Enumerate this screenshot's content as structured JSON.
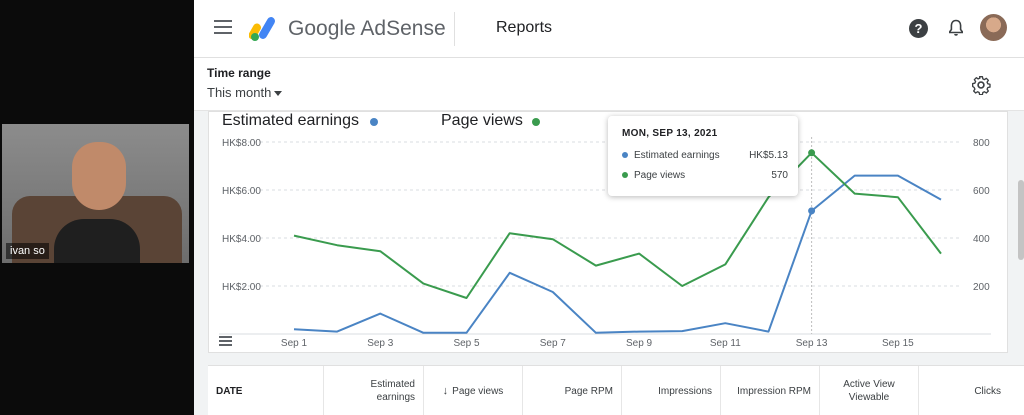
{
  "video": {
    "participant_name": "ivan so"
  },
  "header": {
    "brand": "Google AdSense",
    "section": "Reports",
    "help_symbol": "?"
  },
  "time_range": {
    "label": "Time range",
    "value": "This month"
  },
  "legend": [
    {
      "label": "Estimated earnings",
      "color": "#4a84c4"
    },
    {
      "label": "Page views",
      "color": "#3a9b4e"
    }
  ],
  "tooltip": {
    "date": "MON, SEP 13, 2021",
    "rows": [
      {
        "label": "Estimated earnings",
        "value": "HK$5.13",
        "color": "#4a84c4"
      },
      {
        "label": "Page views",
        "value": "570",
        "color": "#3a9b4e"
      }
    ]
  },
  "chart_data": {
    "type": "line",
    "x": [
      "Sep 1",
      "Sep 2",
      "Sep 3",
      "Sep 4",
      "Sep 5",
      "Sep 6",
      "Sep 7",
      "Sep 8",
      "Sep 9",
      "Sep 10",
      "Sep 11",
      "Sep 12",
      "Sep 13",
      "Sep 14",
      "Sep 15",
      "Sep 16"
    ],
    "x_tick_labels": [
      "Sep 1",
      "Sep 3",
      "Sep 5",
      "Sep 7",
      "Sep 9",
      "Sep 11",
      "Sep 13",
      "Sep 15"
    ],
    "y_left_ticks": [
      "HK$2.00",
      "HK$4.00",
      "HK$6.00",
      "HK$8.00"
    ],
    "y_left_range": [
      0,
      8.0
    ],
    "y_right_ticks": [
      "200",
      "400",
      "600",
      "800"
    ],
    "y_right_range": [
      0,
      800
    ],
    "grid": true,
    "series": [
      {
        "name": "Estimated earnings",
        "axis": "left",
        "color": "#4a84c4",
        "values": [
          0.2,
          0.1,
          0.85,
          0.05,
          0.05,
          2.55,
          1.75,
          0.05,
          0.1,
          0.12,
          0.45,
          0.1,
          5.13,
          6.6,
          6.6,
          5.6
        ]
      },
      {
        "name": "Page views",
        "axis": "right",
        "color": "#3a9b4e",
        "values": [
          410,
          370,
          345,
          210,
          150,
          420,
          395,
          285,
          335,
          200,
          290,
          570,
          755,
          585,
          570,
          335
        ]
      }
    ]
  },
  "table": {
    "columns": [
      {
        "label": "DATE"
      },
      {
        "label": "Estimated earnings"
      },
      {
        "label": "Page views",
        "sort": "↓"
      },
      {
        "label": "Page RPM"
      },
      {
        "label": "Impressions"
      },
      {
        "label": "Impression RPM"
      },
      {
        "label": "Active View Viewable"
      },
      {
        "label": "Clicks"
      }
    ]
  }
}
